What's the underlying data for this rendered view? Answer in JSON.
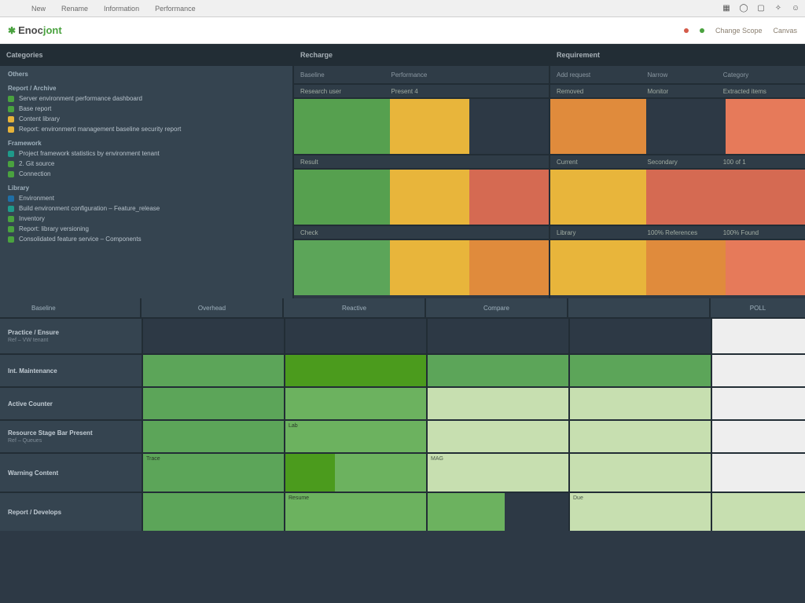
{
  "menu": {
    "tabs": [
      "New",
      "Rename",
      "Information",
      "Performance"
    ],
    "icons": [
      "grid-icon",
      "circle-icon",
      "box-icon",
      "pin-icon",
      "user-icon"
    ]
  },
  "brand": {
    "glyph": "✱",
    "name_a": "Enoc",
    "name_b": "jont",
    "status_online": "●",
    "status_warn": "●",
    "right_a": "Change Scope",
    "right_b": "Canvas"
  },
  "sidebar": {
    "title": "Categories",
    "groups": [
      {
        "title": "Others",
        "items": []
      },
      {
        "title": "Report / Archive",
        "items": [
          {
            "color": "green",
            "label": "Server environment performance dashboard"
          },
          {
            "color": "green",
            "label": "Base report"
          },
          {
            "color": "yellow",
            "label": "Content library"
          },
          {
            "color": "yellow",
            "label": "Report: environment management baseline security report"
          }
        ]
      },
      {
        "title": "Framework",
        "items": [
          {
            "color": "teal",
            "label": "Project framework statistics by environment tenant"
          },
          {
            "color": "green",
            "label": "2. Git source"
          },
          {
            "color": "green",
            "label": "Connection"
          }
        ]
      },
      {
        "title": "Library",
        "items": [
          {
            "color": "blue",
            "label": "Environment"
          },
          {
            "color": "teal",
            "label": "Build environment configuration – Feature_release"
          },
          {
            "color": "green",
            "label": "Inventory"
          },
          {
            "color": "green",
            "label": "Report: library versioning"
          },
          {
            "color": "green",
            "label": "Consolidated feature service – Components"
          }
        ]
      }
    ]
  },
  "panel_a": {
    "title": "Recharge",
    "cols": [
      "Baseline",
      "Performance",
      ""
    ],
    "rows": [
      {
        "label": "Research user",
        "c2": "Present 4",
        "c3": ""
      },
      {
        "label": "Result",
        "c2": "",
        "c3": ""
      },
      {
        "label": "Check",
        "c2": "",
        "c3": ""
      }
    ]
  },
  "panel_b": {
    "title": "Requirement",
    "cols": [
      "Add request",
      "Narrow",
      "Category"
    ],
    "rows": [
      {
        "label": "Removed",
        "c2": "Monitor",
        "c3": "Extracted items"
      },
      {
        "label": "Current",
        "c2": "Secondary",
        "c3": "100 of 1"
      },
      {
        "label": "Library",
        "c2": "100% References",
        "c3": "100% Found"
      }
    ]
  },
  "midcols": [
    "Baseline",
    "Overhead",
    "Reactive",
    "Compare",
    "",
    "POLL"
  ],
  "lower": {
    "rows": [
      {
        "label": "Practice / Ensure",
        "sub": "Ref – VW tenant",
        "right_blank": true
      },
      {
        "label": "Int. Maintenance",
        "sub": "",
        "right_blank": true
      },
      {
        "label": "Active Counter",
        "sub": "",
        "right_blank": true
      },
      {
        "label": "Resource Stage Bar Present",
        "sub": "Ref – Queues",
        "bar_label_a": "Lab",
        "right_blank": true
      },
      {
        "label": "Warning Content",
        "sub": "",
        "bar_label_a": "Trace",
        "bar_label_b": "MAG",
        "right_blank": true
      },
      {
        "label": "Report / Develops",
        "sub": "",
        "bar_label_a": "Resume",
        "bar_label_b": "Due",
        "right_blank": false
      }
    ]
  },
  "chart_data": [
    {
      "type": "heatmap",
      "title": "Recharge",
      "categories_x": [
        "Baseline",
        "Performance",
        "(blank)"
      ],
      "categories_y": [
        "Research user",
        "Result",
        "Check"
      ],
      "values": [
        [
          "green",
          "amber",
          "empty"
        ],
        [
          "green",
          "amber",
          "red"
        ],
        [
          "green",
          "amber",
          "orange"
        ]
      ]
    },
    {
      "type": "heatmap",
      "title": "Requirement",
      "categories_x": [
        "Add request",
        "Narrow",
        "Category"
      ],
      "categories_y": [
        "Removed",
        "Current",
        "Library"
      ],
      "values": [
        [
          "amber-dark",
          "empty",
          "orange"
        ],
        [
          "amber",
          "red",
          "red"
        ],
        [
          "amber",
          "orange",
          "orange"
        ]
      ]
    },
    {
      "type": "heatmap",
      "title": "Lower status grid",
      "categories_x": [
        "Overhead",
        "Reactive",
        "Compare",
        "",
        "POLL"
      ],
      "categories_y": [
        "Practice / Ensure",
        "Int. Maintenance",
        "Active Counter",
        "Resource Stage Bar Present",
        "Warning Content",
        "Report / Develops"
      ],
      "values": [
        [
          "dark",
          "dark",
          "dark",
          "dark",
          "white"
        ],
        [
          "green",
          "green-dark",
          "green",
          "green",
          "white"
        ],
        [
          "green",
          "green",
          "green-light",
          "green-light",
          "white"
        ],
        [
          "green",
          "green",
          "green-light",
          "green-light",
          "white"
        ],
        [
          "green",
          "green-dark-accent",
          "green-light",
          "green-light",
          "white"
        ],
        [
          "green",
          "green",
          "green / dark",
          "green-light",
          "green-light"
        ]
      ]
    }
  ]
}
